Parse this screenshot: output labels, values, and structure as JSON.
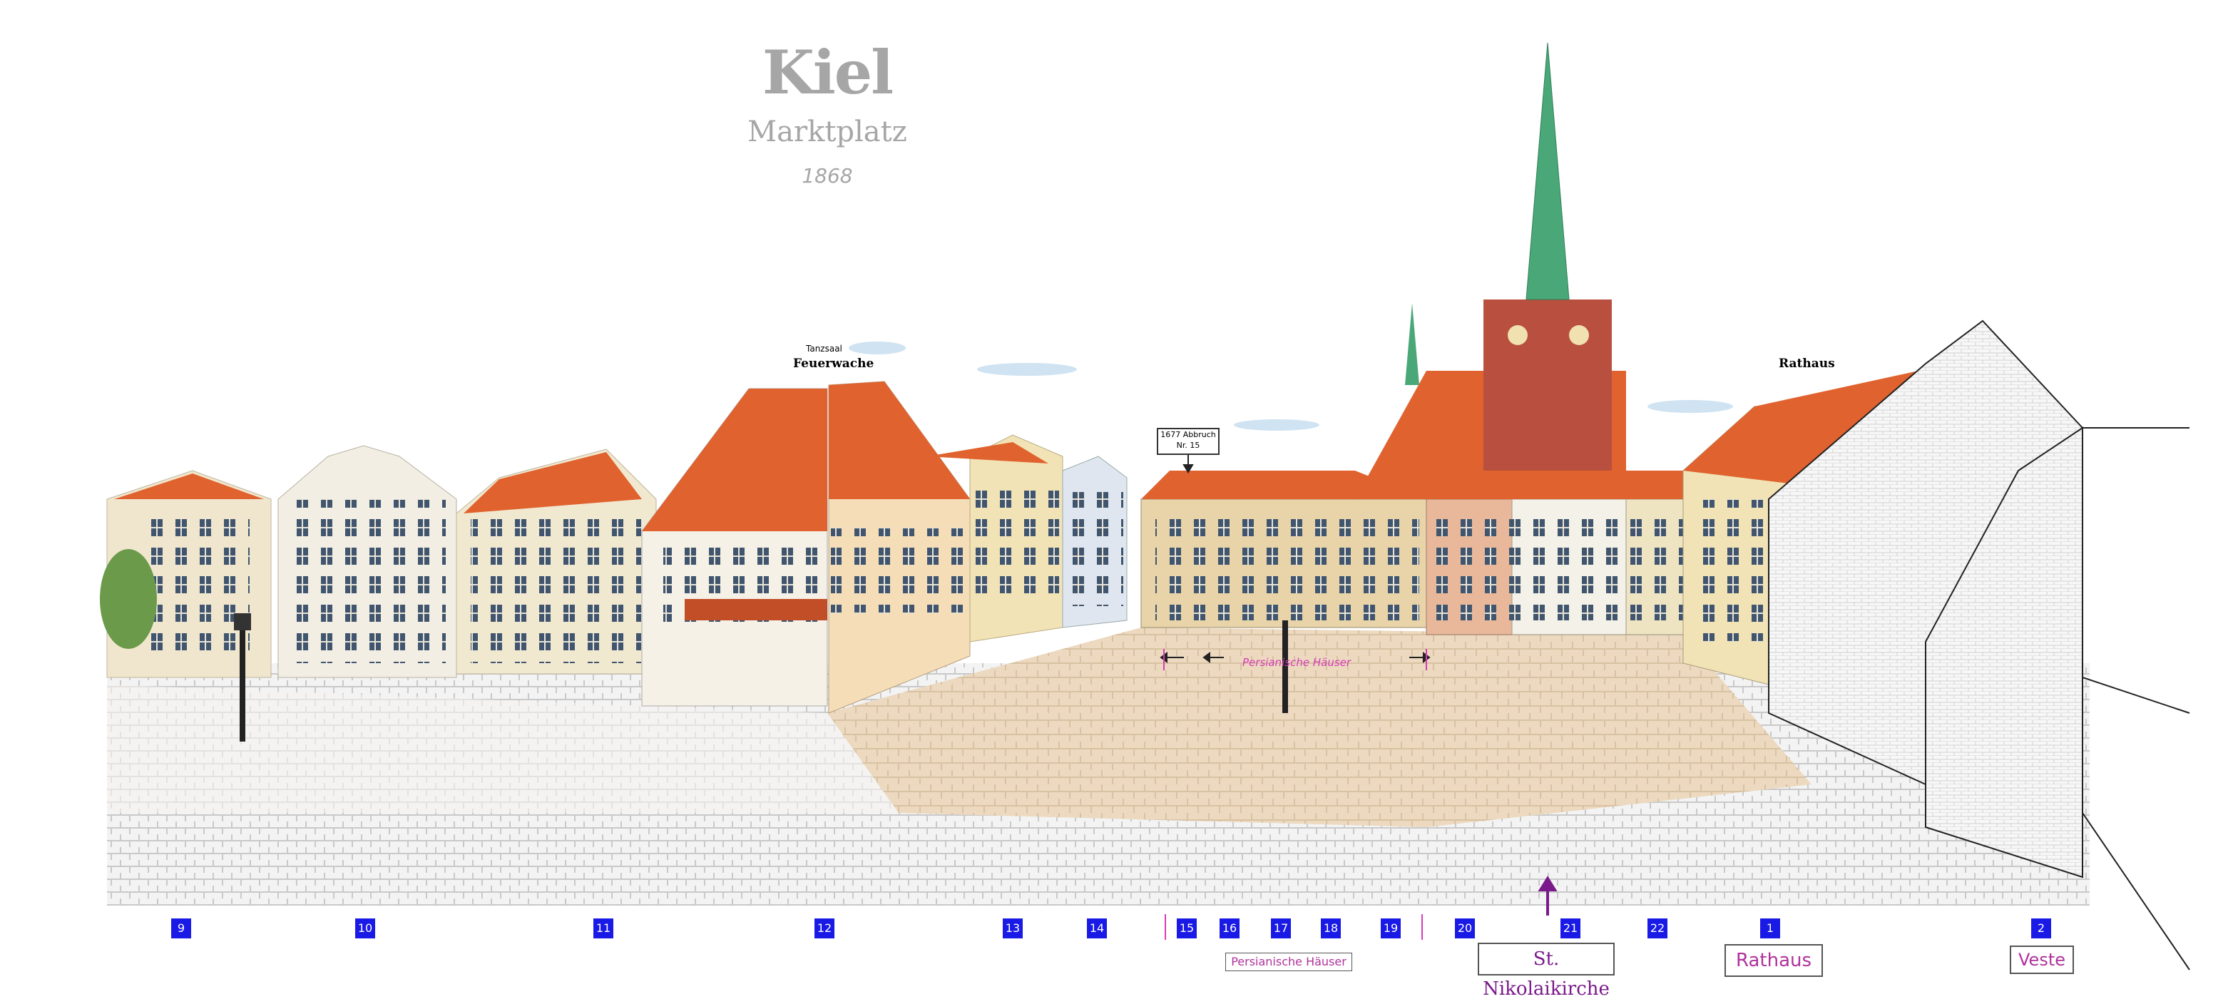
{
  "title": {
    "city": "Kiel",
    "place": "Marktplatz",
    "year": "1868"
  },
  "labels": {
    "tanzsaal": "Tanzsaal",
    "feuerwache": "Feuerwache",
    "rathaus_top": "Rathaus",
    "abbruch_line1": "1677 Abbruch",
    "abbruch_line2": "Nr. 15",
    "persian_span": "Persianische Häuser"
  },
  "numbers": [
    "9",
    "10",
    "11",
    "12",
    "13",
    "14",
    "15",
    "16",
    "17",
    "18",
    "19",
    "20",
    "21",
    "22",
    "1",
    "2"
  ],
  "bottom_names": {
    "persian": "Persianische Häuser",
    "nikolai": "St. Nikolaikirche",
    "rathaus": "Rathaus",
    "veste": "Veste"
  },
  "colors": {
    "number_box": "#1a1ae6",
    "magenta": "#d63cb8",
    "roof": "#e0622e",
    "spire": "#4aa878",
    "tower_brick": "#b9503f"
  }
}
